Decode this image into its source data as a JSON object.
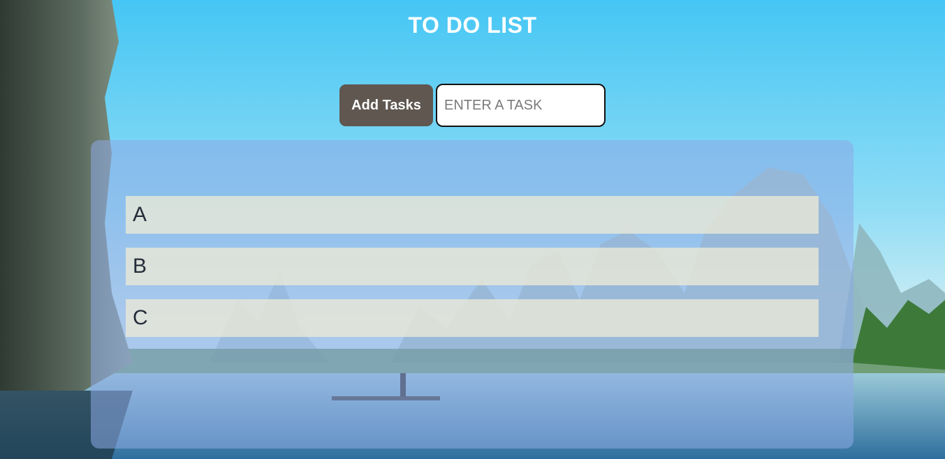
{
  "header": {
    "title": "TO DO LIST"
  },
  "form": {
    "add_button_label": "Add Tasks",
    "input_placeholder": "ENTER A TASK",
    "input_value": ""
  },
  "tasks": [
    {
      "label": "A"
    },
    {
      "label": "B"
    },
    {
      "label": "C"
    }
  ],
  "colors": {
    "add_button_bg": "#5f5750",
    "title_text": "#ffffff",
    "sky": "#4fc8f2"
  }
}
